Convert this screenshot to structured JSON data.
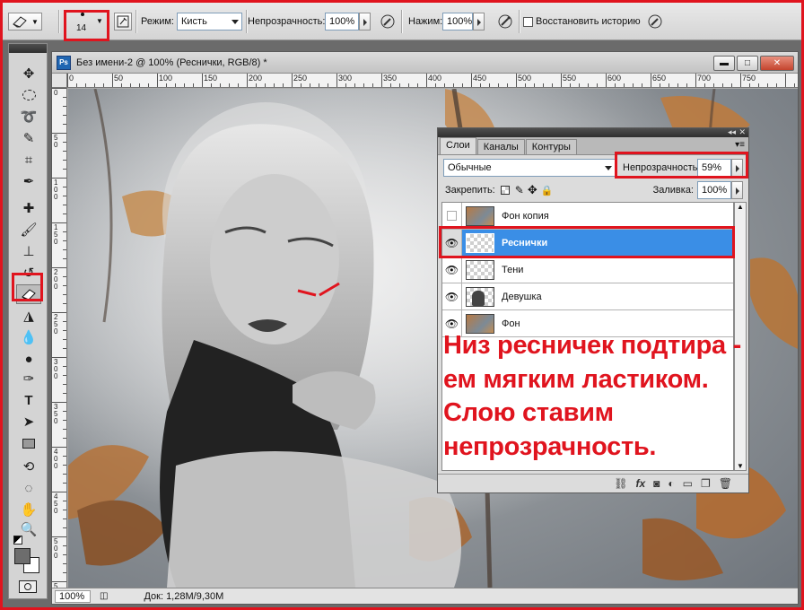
{
  "options_bar": {
    "brush_size": "14",
    "mode_label": "Режим:",
    "mode_value": "Кисть",
    "opacity_label": "Непрозрачность:",
    "opacity_value": "100%",
    "flow_label": "Нажим:",
    "flow_value": "100%",
    "restore_history_label": "Восстановить историю"
  },
  "document": {
    "title": "Без имени-2 @ 100% (Реснички, RGB/8) *",
    "ps_badge": "Ps",
    "zoom": "100%",
    "doc_info": "Док: 1,28M/9,30M",
    "ruler_h": [
      "0",
      "50",
      "100",
      "150",
      "200",
      "250",
      "300",
      "350",
      "400",
      "450",
      "500",
      "550",
      "600",
      "650",
      "700",
      "750"
    ],
    "ruler_v": [
      "0",
      "5\n0",
      "1\n0\n0",
      "1\n5\n0",
      "2\n0\n0",
      "2\n5\n0",
      "3\n0\n0",
      "3\n5\n0",
      "4\n0\n0",
      "4\n5\n0",
      "5\n0\n0",
      "5\n5\n0"
    ]
  },
  "layers_panel": {
    "tabs": [
      "Слои",
      "Каналы",
      "Контуры"
    ],
    "blend_mode": "Обычные",
    "opacity_label": "Непрозрачность:",
    "opacity_value": "59%",
    "lock_label": "Закрепить:",
    "fill_label": "Заливка:",
    "fill_value": "100%",
    "layers": [
      {
        "name": "Фон копия",
        "visible": false,
        "selected": false,
        "thumb": "photo"
      },
      {
        "name": "Реснички",
        "visible": true,
        "selected": true,
        "thumb": "transparent"
      },
      {
        "name": "Тени",
        "visible": true,
        "selected": false,
        "thumb": "transparent"
      },
      {
        "name": "Девушка",
        "visible": true,
        "selected": false,
        "thumb": "figure"
      },
      {
        "name": "Фон",
        "visible": true,
        "selected": false,
        "thumb": "photo"
      }
    ],
    "bottom_icons": [
      "link-icon",
      "fx-icon",
      "mask-icon",
      "adjustment-icon",
      "group-folder-icon",
      "new-layer-icon",
      "trash-icon"
    ]
  },
  "annotation": {
    "text": "Низ ресничек подтира -\nем мягким ластиком.\nСлою ставим\nнепрозрачность."
  },
  "colors": {
    "highlight": "#e0141e",
    "selection": "#3a8ee6"
  }
}
